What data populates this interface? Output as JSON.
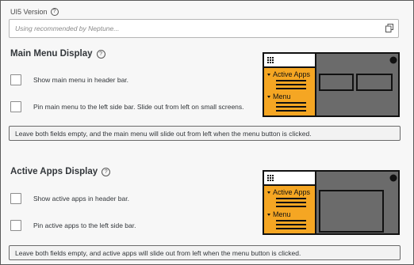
{
  "ui5": {
    "label": "UI5 Version",
    "placeholder": "Using recommended by Neptune...",
    "help_icon": "question-icon",
    "copy_icon": "copy-icon"
  },
  "main_menu": {
    "title": "Main Menu Display",
    "options": [
      {
        "label": "Show main menu in header bar.",
        "checked": false
      },
      {
        "label": "Pin main menu to the left side bar. Slide out from left on small screens.",
        "checked": false
      }
    ],
    "info": "Leave both fields empty, and the main menu will slide out from left when the menu button is clicked.",
    "illustration": {
      "item1": "Active Apps",
      "item2": "Menu"
    }
  },
  "active_apps": {
    "title": "Active Apps Display",
    "options": [
      {
        "label": "Show active apps in header bar.",
        "checked": false
      },
      {
        "label": "Pin active apps to the left side bar.",
        "checked": false
      }
    ],
    "info": "Leave both fields empty, and active apps will slide out from left when the menu button is clicked.",
    "illustration": {
      "item1": "Active Apps",
      "item2": "Menu"
    }
  },
  "colors": {
    "accent": "#f5a623",
    "dark": "#6b6b6b"
  }
}
